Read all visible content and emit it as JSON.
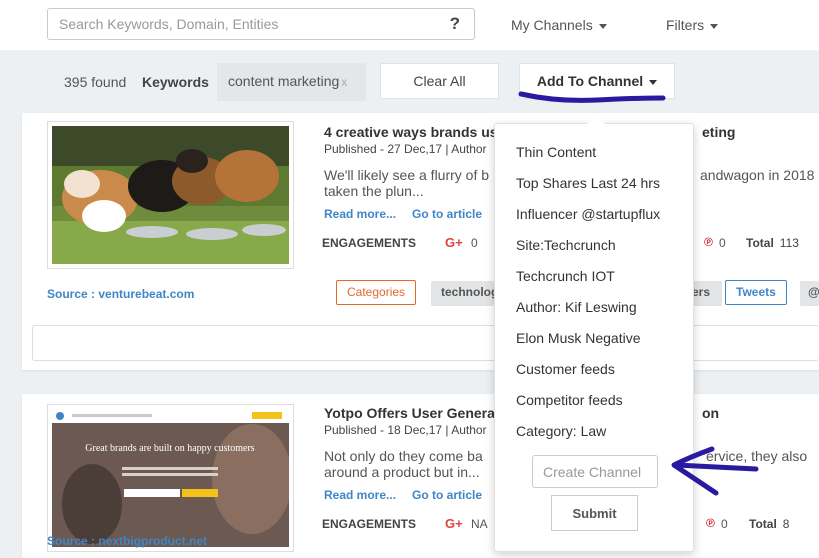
{
  "header": {
    "search_placeholder": "Search Keywords, Domain, Entities",
    "help_label": "?",
    "my_channels_label": "My Channels",
    "filters_label": "Filters"
  },
  "filters": {
    "found_text": "395 found",
    "keywords_label": "Keywords",
    "keyword_chip": "content marketing",
    "chip_remove": "x",
    "clear_all_label": "Clear All",
    "add_to_channel_label": "Add To Channel"
  },
  "articles": [
    {
      "title": "4 creative ways brands us",
      "title_tail": "eting",
      "published": "Published - 27 Dec,17 | Author",
      "description": "We'll likely see a flurry of b taken the plun...",
      "description_tail": "andwagon in 2018",
      "read_more": "Read more...",
      "go_to_article": "Go to article",
      "engagements_label": "ENGAGEMENTS",
      "gplus_icon_label": "G+",
      "gplus_count": "0",
      "pinterest_icon_label": "℗",
      "pinterest_count": "0",
      "total_label": "Total",
      "total_count": "113",
      "source": "Source : venturebeat.com",
      "categories_label": "Categories",
      "tag_technology": "technolog",
      "tag_tail": "ers",
      "tweets_label": "Tweets",
      "tag_last": "@"
    },
    {
      "title": "Yotpo Offers User Genera",
      "title_tail": "on",
      "published": "Published - 18 Dec,17 | Author",
      "description": "Not only do they come ba around a product but in...",
      "description_tail": "ervice, they also",
      "read_more": "Read more...",
      "go_to_article": "Go to article",
      "engagements_label": "ENGAGEMENTS",
      "gplus_icon_label": "G+",
      "gplus_count": "NA",
      "pinterest_icon_label": "℗",
      "pinterest_count": "0",
      "total_label": "Total",
      "total_count": "8",
      "source": "Source : nextbigproduct.net",
      "thumbnail_headline": "Great brands are built on happy customers"
    }
  ],
  "dropdown": {
    "items": [
      "Thin Content",
      "Top Shares Last 24 hrs",
      "Influencer @startupflux",
      "Site:Techcrunch",
      "Techcrunch IOT",
      "Author: Kif Leswing",
      "Elon Musk Negative",
      "Customer feeds",
      "Competitor feeds",
      "Category: Law"
    ],
    "create_placeholder": "Create Channel",
    "submit_label": "Submit"
  },
  "colors": {
    "link_blue": "#3f86c7",
    "category_orange": "#e26a2c",
    "gplus_red": "#d9473d",
    "annotation_ink": "#2a1aa0"
  }
}
